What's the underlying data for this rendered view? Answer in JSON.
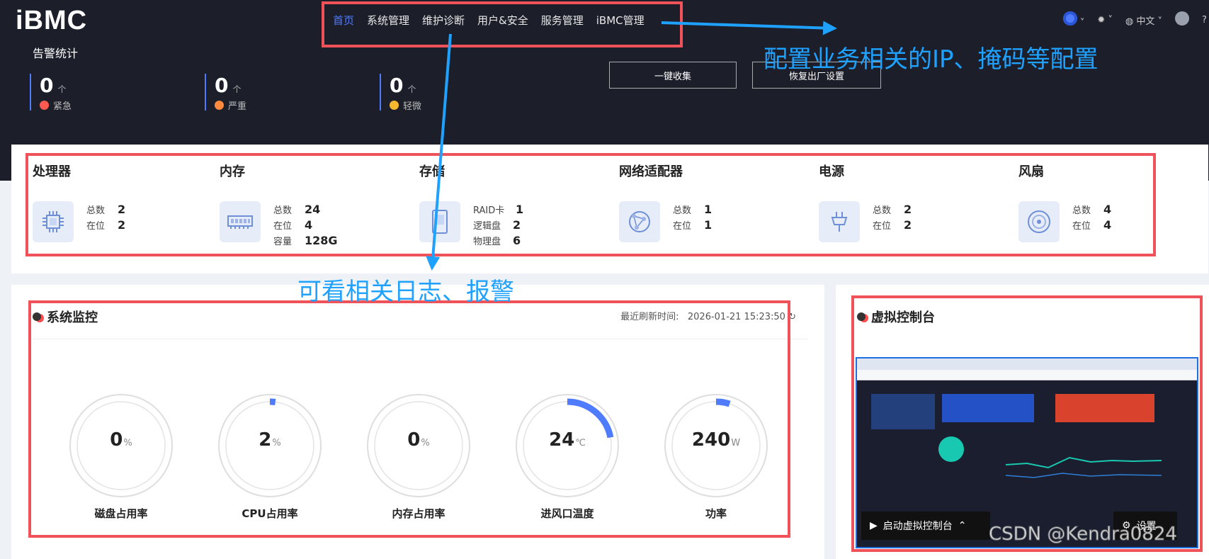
{
  "app": {
    "title": "iBMC"
  },
  "nav": {
    "items": [
      "首页",
      "系统管理",
      "维护诊断",
      "用户&安全",
      "服务管理",
      "iBMC管理"
    ]
  },
  "header": {
    "language": "中文"
  },
  "alarms": {
    "title": "告警统计",
    "unit": "个",
    "items": [
      {
        "count": "0",
        "label": "紧急",
        "color": "#ff5a4f"
      },
      {
        "count": "0",
        "label": "严重",
        "color": "#ff8a3d"
      },
      {
        "count": "0",
        "label": "轻微",
        "color": "#f5b72e"
      }
    ]
  },
  "actions": {
    "collect": "一键收集",
    "reset": "恢复出厂设置"
  },
  "summary": [
    {
      "title": "处理器",
      "icon": "cpu-icon",
      "rows": [
        {
          "k": "总数",
          "v": "2"
        },
        {
          "k": "在位",
          "v": "2"
        }
      ]
    },
    {
      "title": "内存",
      "icon": "memory-icon",
      "rows": [
        {
          "k": "总数",
          "v": "24"
        },
        {
          "k": "在位",
          "v": "4"
        },
        {
          "k": "容量",
          "v": "128G"
        }
      ]
    },
    {
      "title": "存储",
      "icon": "storage-icon",
      "rows": [
        {
          "k": "RAID卡",
          "v": "1"
        },
        {
          "k": "逻辑盘",
          "v": "2"
        },
        {
          "k": "物理盘",
          "v": "6"
        }
      ]
    },
    {
      "title": "网络适配器",
      "icon": "network-icon",
      "rows": [
        {
          "k": "总数",
          "v": "1"
        },
        {
          "k": "在位",
          "v": "1"
        }
      ]
    },
    {
      "title": "电源",
      "icon": "power-plug-icon",
      "rows": [
        {
          "k": "总数",
          "v": "2"
        },
        {
          "k": "在位",
          "v": "2"
        }
      ]
    },
    {
      "title": "风扇",
      "icon": "fan-icon",
      "rows": [
        {
          "k": "总数",
          "v": "4"
        },
        {
          "k": "在位",
          "v": "4"
        }
      ]
    }
  ],
  "monitor": {
    "title": "系统监控",
    "refresh_label": "最近刷新时间:",
    "refresh_time": "2026-01-21 15:23:50",
    "gauges": [
      {
        "value": "0",
        "unit": "%",
        "label": "磁盘占用率",
        "fraction": 0
      },
      {
        "value": "2",
        "unit": "%",
        "label": "CPU占用率",
        "fraction": 0.02
      },
      {
        "value": "0",
        "unit": "%",
        "label": "内存占用率",
        "fraction": 0
      },
      {
        "value": "24",
        "unit": "℃",
        "label": "进风口温度",
        "fraction": 0.22
      },
      {
        "value": "240",
        "unit": "W",
        "label": "功率",
        "fraction": 0.05
      }
    ]
  },
  "console": {
    "title": "虚拟控制台",
    "launch": "启动虚拟控制台",
    "settings": "设置"
  },
  "annotations": {
    "config": "配置业务相关的IP、掩码等配置",
    "logs": "可看相关日志、报警"
  },
  "watermark": "CSDN @Kendra0824",
  "colors": {
    "accent": "#4f7bff",
    "annotation": "#1fa2ff",
    "highlight_box": "#f0525a"
  }
}
